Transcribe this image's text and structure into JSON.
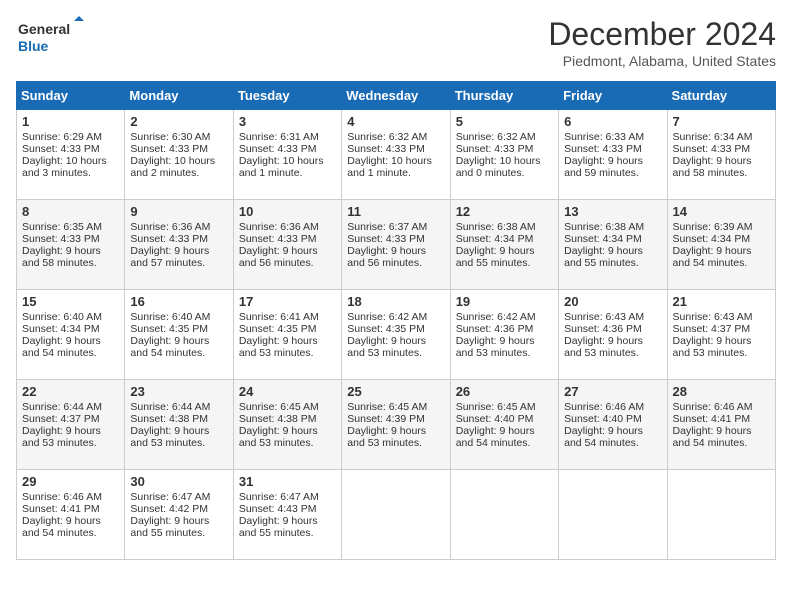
{
  "header": {
    "logo_line1": "General",
    "logo_line2": "Blue",
    "month": "December 2024",
    "location": "Piedmont, Alabama, United States"
  },
  "days_of_week": [
    "Sunday",
    "Monday",
    "Tuesday",
    "Wednesday",
    "Thursday",
    "Friday",
    "Saturday"
  ],
  "weeks": [
    [
      {
        "day": "1",
        "rise": "6:29 AM",
        "set": "4:33 PM",
        "daylight": "10 hours and 3 minutes."
      },
      {
        "day": "2",
        "rise": "6:30 AM",
        "set": "4:33 PM",
        "daylight": "10 hours and 2 minutes."
      },
      {
        "day": "3",
        "rise": "6:31 AM",
        "set": "4:33 PM",
        "daylight": "10 hours and 1 minute."
      },
      {
        "day": "4",
        "rise": "6:32 AM",
        "set": "4:33 PM",
        "daylight": "10 hours and 1 minute."
      },
      {
        "day": "5",
        "rise": "6:32 AM",
        "set": "4:33 PM",
        "daylight": "10 hours and 0 minutes."
      },
      {
        "day": "6",
        "rise": "6:33 AM",
        "set": "4:33 PM",
        "daylight": "9 hours and 59 minutes."
      },
      {
        "day": "7",
        "rise": "6:34 AM",
        "set": "4:33 PM",
        "daylight": "9 hours and 58 minutes."
      }
    ],
    [
      {
        "day": "8",
        "rise": "6:35 AM",
        "set": "4:33 PM",
        "daylight": "9 hours and 58 minutes."
      },
      {
        "day": "9",
        "rise": "6:36 AM",
        "set": "4:33 PM",
        "daylight": "9 hours and 57 minutes."
      },
      {
        "day": "10",
        "rise": "6:36 AM",
        "set": "4:33 PM",
        "daylight": "9 hours and 56 minutes."
      },
      {
        "day": "11",
        "rise": "6:37 AM",
        "set": "4:33 PM",
        "daylight": "9 hours and 56 minutes."
      },
      {
        "day": "12",
        "rise": "6:38 AM",
        "set": "4:34 PM",
        "daylight": "9 hours and 55 minutes."
      },
      {
        "day": "13",
        "rise": "6:38 AM",
        "set": "4:34 PM",
        "daylight": "9 hours and 55 minutes."
      },
      {
        "day": "14",
        "rise": "6:39 AM",
        "set": "4:34 PM",
        "daylight": "9 hours and 54 minutes."
      }
    ],
    [
      {
        "day": "15",
        "rise": "6:40 AM",
        "set": "4:34 PM",
        "daylight": "9 hours and 54 minutes."
      },
      {
        "day": "16",
        "rise": "6:40 AM",
        "set": "4:35 PM",
        "daylight": "9 hours and 54 minutes."
      },
      {
        "day": "17",
        "rise": "6:41 AM",
        "set": "4:35 PM",
        "daylight": "9 hours and 53 minutes."
      },
      {
        "day": "18",
        "rise": "6:42 AM",
        "set": "4:35 PM",
        "daylight": "9 hours and 53 minutes."
      },
      {
        "day": "19",
        "rise": "6:42 AM",
        "set": "4:36 PM",
        "daylight": "9 hours and 53 minutes."
      },
      {
        "day": "20",
        "rise": "6:43 AM",
        "set": "4:36 PM",
        "daylight": "9 hours and 53 minutes."
      },
      {
        "day": "21",
        "rise": "6:43 AM",
        "set": "4:37 PM",
        "daylight": "9 hours and 53 minutes."
      }
    ],
    [
      {
        "day": "22",
        "rise": "6:44 AM",
        "set": "4:37 PM",
        "daylight": "9 hours and 53 minutes."
      },
      {
        "day": "23",
        "rise": "6:44 AM",
        "set": "4:38 PM",
        "daylight": "9 hours and 53 minutes."
      },
      {
        "day": "24",
        "rise": "6:45 AM",
        "set": "4:38 PM",
        "daylight": "9 hours and 53 minutes."
      },
      {
        "day": "25",
        "rise": "6:45 AM",
        "set": "4:39 PM",
        "daylight": "9 hours and 53 minutes."
      },
      {
        "day": "26",
        "rise": "6:45 AM",
        "set": "4:40 PM",
        "daylight": "9 hours and 54 minutes."
      },
      {
        "day": "27",
        "rise": "6:46 AM",
        "set": "4:40 PM",
        "daylight": "9 hours and 54 minutes."
      },
      {
        "day": "28",
        "rise": "6:46 AM",
        "set": "4:41 PM",
        "daylight": "9 hours and 54 minutes."
      }
    ],
    [
      {
        "day": "29",
        "rise": "6:46 AM",
        "set": "4:41 PM",
        "daylight": "9 hours and 54 minutes."
      },
      {
        "day": "30",
        "rise": "6:47 AM",
        "set": "4:42 PM",
        "daylight": "9 hours and 55 minutes."
      },
      {
        "day": "31",
        "rise": "6:47 AM",
        "set": "4:43 PM",
        "daylight": "9 hours and 55 minutes."
      },
      null,
      null,
      null,
      null
    ]
  ],
  "labels": {
    "sunrise": "Sunrise:",
    "sunset": "Sunset:",
    "daylight": "Daylight:"
  }
}
